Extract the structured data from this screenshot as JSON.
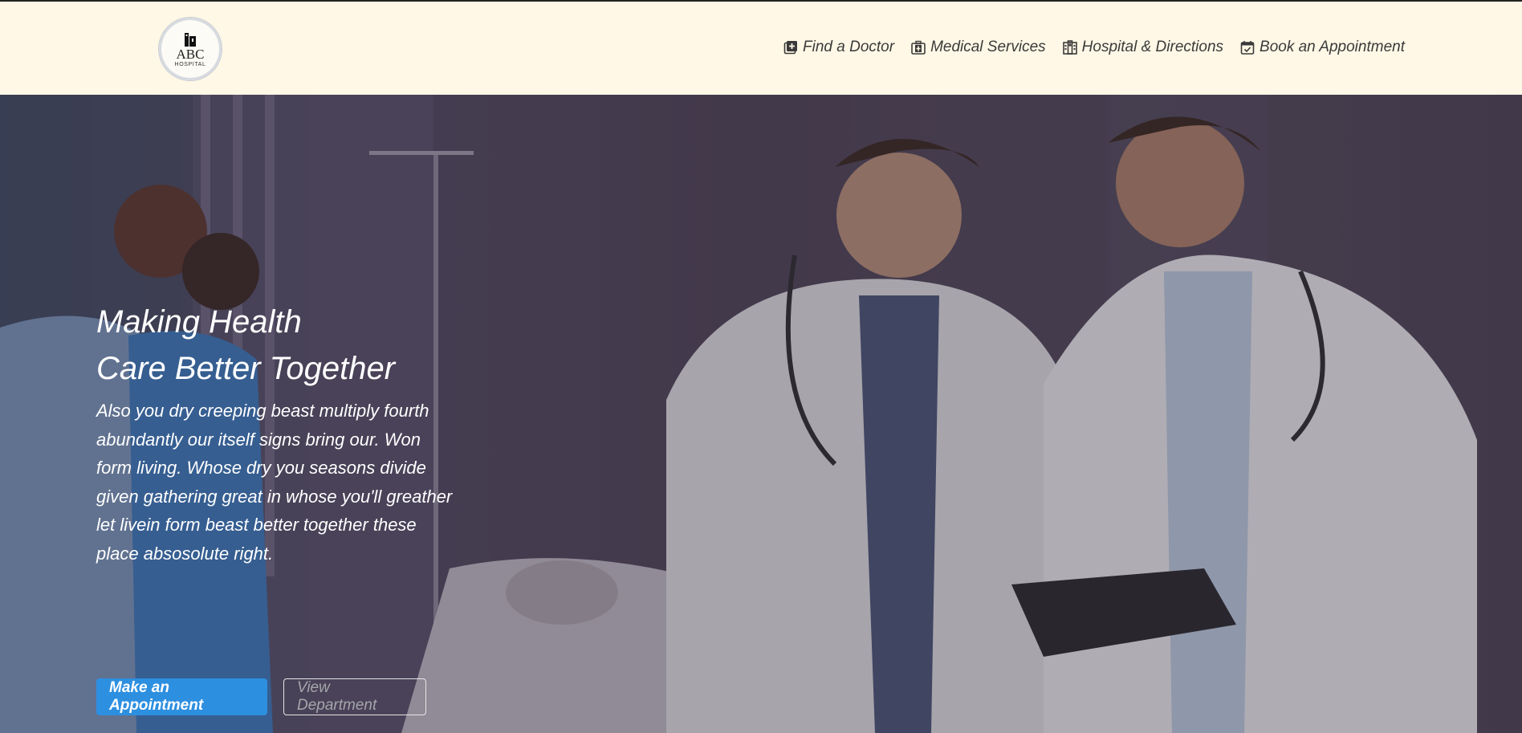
{
  "logo": {
    "name": "ABC",
    "subtitle": "HOSPITAL"
  },
  "nav": [
    {
      "label": "Find a Doctor",
      "icon": "doctor-plus-icon"
    },
    {
      "label": "Medical Services",
      "icon": "medical-kit-icon"
    },
    {
      "label": "Hospital & Directions",
      "icon": "hospital-building-icon"
    },
    {
      "label": "Book an Appointment",
      "icon": "calendar-check-icon"
    }
  ],
  "hero": {
    "title_line1": "Making Health",
    "title_line2": "Care Better Together",
    "text": "Also you dry creeping beast multiply fourth abundantly our itself signs bring our. Won form living. Whose dry you seasons divide given gathering great in whose you'll greather let livein form beast better together these place absosolute right.",
    "primary_button": "Make an Appointment",
    "secondary_button": "View Department"
  },
  "colors": {
    "header_bg": "#fff8e6",
    "primary": "#2d8fe0"
  }
}
